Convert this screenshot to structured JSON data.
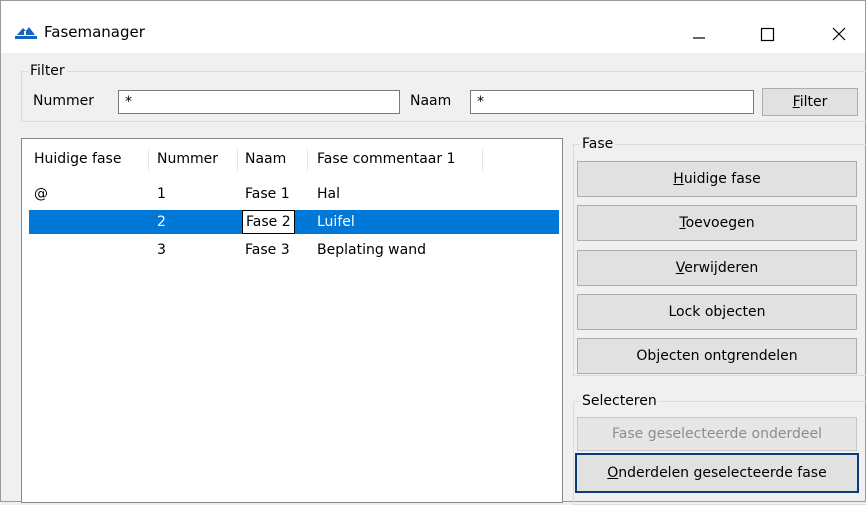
{
  "window": {
    "title": "Fasemanager",
    "app_icon": "fasemanager-app-icon",
    "controls": [
      "minimize-icon",
      "maximize-icon",
      "close-icon"
    ]
  },
  "filter": {
    "legend": "Filter",
    "nummer_label": "Nummer",
    "nummer_value": "*",
    "naam_label": "Naam",
    "naam_value": "*",
    "button": {
      "prefix": "",
      "accel": "F",
      "suffix": "ilter"
    }
  },
  "list": {
    "columns": [
      "Huidige fase",
      "Nummer",
      "Naam",
      "Fase commentaar 1"
    ],
    "rows": [
      {
        "huidige": "@",
        "nummer": "1",
        "naam": "Fase 1",
        "commentaar": "Hal"
      },
      {
        "huidige": "",
        "nummer": "2",
        "naam": "Fase 2",
        "commentaar": "Luifel"
      },
      {
        "huidige": "",
        "nummer": "3",
        "naam": "Fase 3",
        "commentaar": "Beplating wand"
      }
    ],
    "selected_row": 2
  },
  "fase": {
    "legend": "Fase",
    "huidige_fase": {
      "prefix": "",
      "accel": "H",
      "suffix": "uidige fase"
    },
    "toevoegen": {
      "prefix": "",
      "accel": "T",
      "suffix": "oevoegen"
    },
    "verwijderen": {
      "prefix": "",
      "accel": "V",
      "suffix": "erwijderen"
    },
    "lock_objecten": "Lock objecten",
    "objecten_ontgrendelen": "Objecten ontgrendelen"
  },
  "selecteren": {
    "legend": "Selecteren",
    "fase_geselecteerde_onderdeel": "Fase geselecteerde onderdeel",
    "onderdelen_geselecteerde_fase": {
      "prefix": "",
      "accel": "O",
      "suffix": "nderdelen geselecteerde fase"
    }
  },
  "colors": {
    "selection": "#0078d7",
    "default_button_border": "#0a3a78",
    "app_icon": "#1565c0"
  }
}
